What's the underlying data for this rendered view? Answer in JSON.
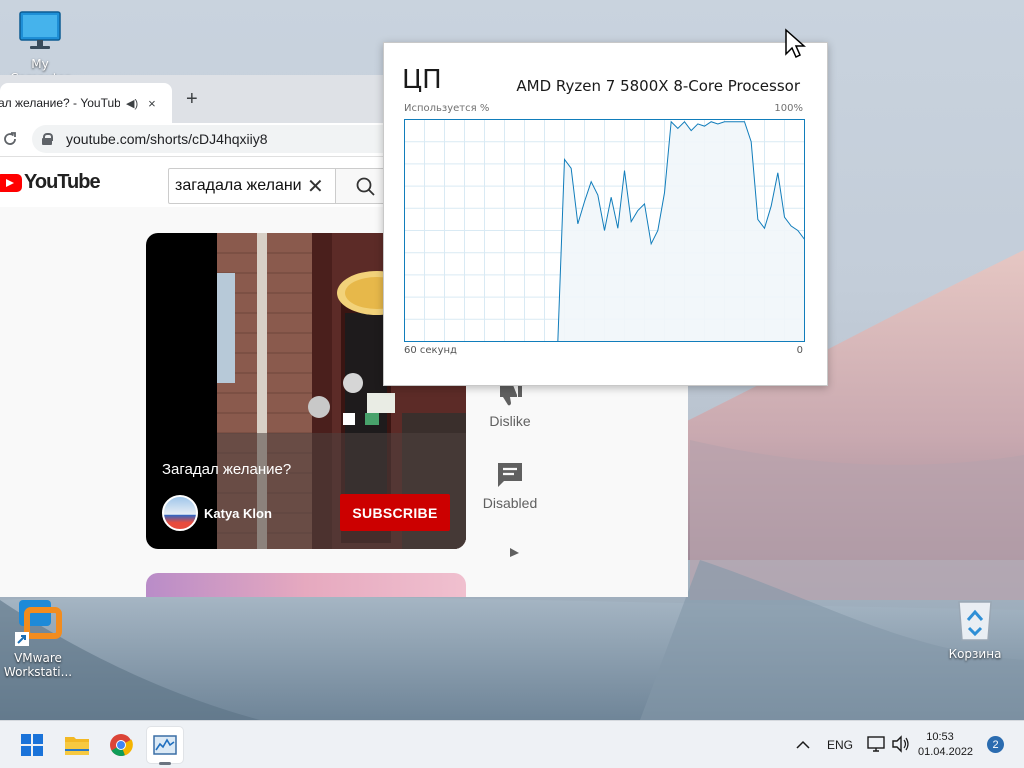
{
  "desktop": {
    "icons": [
      {
        "label": "My Computer",
        "icon": "monitor-icon"
      },
      {
        "label": "VMware Workstati...",
        "icon": "vmware-icon"
      },
      {
        "label": "Корзина",
        "icon": "recycle-bin-icon"
      }
    ]
  },
  "browser": {
    "tab": {
      "title": "ал желание? - YouTube",
      "audio_icon": "speaker-icon",
      "close": "×"
    },
    "new_tab": "+",
    "url": "youtube.com/shorts/cDJ4hqxiiy8",
    "youtube": {
      "logo": "YouTube",
      "search_value": "загадала желани",
      "search_clear": "✕"
    },
    "short": {
      "caption": "Загадал желание?",
      "author": "Katya Klon",
      "subscribe_label": "SUBSCRIBE"
    },
    "actions": {
      "dislike_label": "Dislike",
      "comments_label": "Disabled"
    }
  },
  "cpu_panel": {
    "title": "ЦП",
    "model": "AMD Ryzen 7 5800X 8-Core Processor",
    "y_label": "Используется %",
    "y_max": "100%",
    "x_left": "60 секунд",
    "x_right": "0"
  },
  "chart_data": {
    "type": "area",
    "title": "ЦП",
    "ylabel": "Используется %",
    "ylim": [
      0,
      100
    ],
    "x_range_seconds": [
      60,
      0
    ],
    "grid": true,
    "x": [
      60,
      59,
      58,
      57,
      56,
      55,
      54,
      53,
      52,
      51,
      50,
      49,
      48,
      47,
      46,
      45,
      44,
      43,
      42,
      41,
      40,
      39,
      38,
      37,
      36,
      35,
      34,
      33,
      32,
      31,
      30,
      29,
      28,
      27,
      26,
      25,
      24,
      23,
      22,
      21,
      20,
      19,
      18,
      17,
      16,
      15,
      14,
      13,
      12,
      11,
      10,
      9,
      8,
      7,
      6,
      5,
      4,
      3,
      2,
      1,
      0
    ],
    "values": [
      0,
      0,
      0,
      0,
      0,
      0,
      0,
      0,
      0,
      0,
      0,
      0,
      0,
      0,
      0,
      0,
      0,
      0,
      0,
      0,
      0,
      0,
      0,
      0,
      82,
      78,
      53,
      63,
      72,
      66,
      50,
      65,
      51,
      77,
      54,
      59,
      62,
      44,
      50,
      67,
      99,
      96,
      99,
      95,
      98,
      97,
      99,
      98,
      99,
      99,
      99,
      99,
      90,
      55,
      51,
      61,
      76,
      56,
      52,
      50,
      46
    ],
    "color": "#117dbb",
    "fill": "#f1f6fa"
  },
  "taskbar": {
    "lang": "ENG",
    "time": "10:53",
    "date": "01.04.2022",
    "notifications": "2",
    "apps": [
      "windows-start-icon",
      "file-explorer-icon",
      "chrome-icon",
      "task-manager-icon"
    ]
  }
}
